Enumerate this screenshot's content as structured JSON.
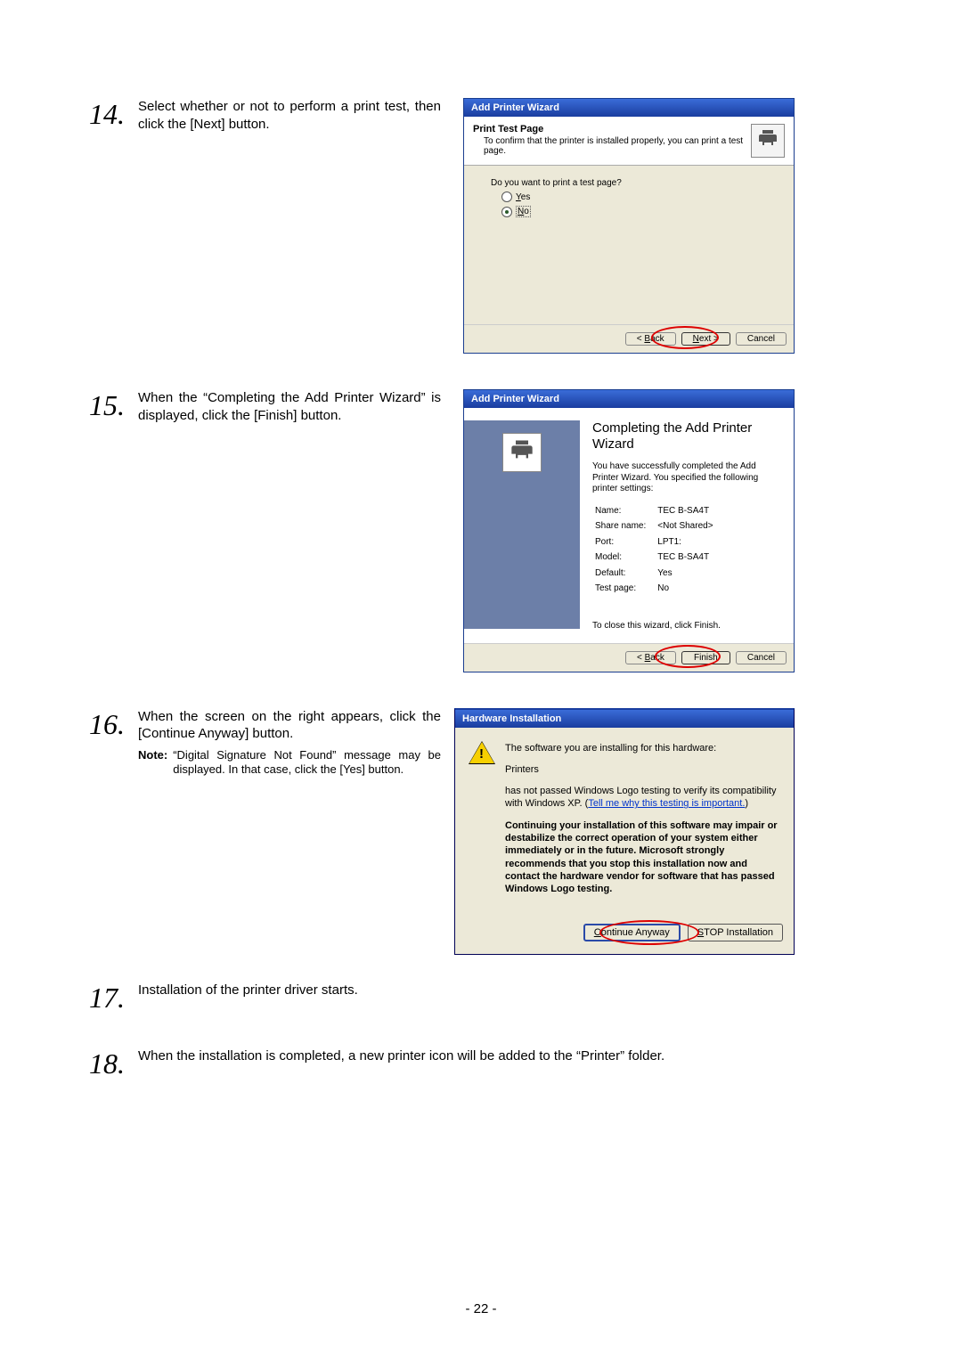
{
  "steps": {
    "s14": {
      "num": "14.",
      "text": "Select whether or not to perform a print test, then click the [Next] button."
    },
    "s15": {
      "num": "15.",
      "text": "When the “Completing the Add Printer Wizard” is displayed, click the [Finish] button."
    },
    "s16": {
      "num": "16.",
      "text": "When the screen on the right appears, click the [Continue Anyway] button.",
      "note_label": "Note:",
      "note_text": "“Digital Signature Not Found” message may be displayed.  In that case, click the [Yes] button."
    },
    "s17": {
      "num": "17.",
      "text": "Installation of the printer driver starts."
    },
    "s18": {
      "num": "18.",
      "text": "When the installation is completed, a new printer icon will be added to the “Printer” folder."
    }
  },
  "wizard1": {
    "title": "Add Printer Wizard",
    "header_title": "Print Test Page",
    "header_sub": "To confirm that the printer is installed properly, you can print a test page.",
    "question": "Do you want to print a test page?",
    "opt_yes_pre": "Y",
    "opt_yes_post": "es",
    "opt_no_pre": "N",
    "opt_no_post": "o",
    "back_pre": "< ",
    "back_u": "B",
    "back_post": "ack",
    "next_u": "N",
    "next_post": "ext >",
    "cancel": "Cancel"
  },
  "wizard2": {
    "title": "Add Printer Wizard",
    "complete_title": "Completing the Add Printer Wizard",
    "sub1": "You have successfully completed the Add Printer Wizard. You specified the following printer settings:",
    "labels": {
      "name": "Name:",
      "name_v": "TEC B-SA4T",
      "share": "Share name:",
      "share_v": "<Not Shared>",
      "port": "Port:",
      "port_v": "LPT1:",
      "model": "Model:",
      "model_v": "TEC B-SA4T",
      "default": "Default:",
      "default_v": "Yes",
      "test": "Test page:",
      "test_v": "No"
    },
    "close_text": "To close this wizard, click Finish.",
    "back_pre": "< ",
    "back_u": "B",
    "back_post": "ack",
    "finish": "Finish",
    "cancel": "Cancel"
  },
  "hw": {
    "title": "Hardware Installation",
    "line1": "The software you are installing for this hardware:",
    "line2": "Printers",
    "line3a": "has not passed Windows Logo testing to verify its compatibility with Windows XP. (",
    "link": "Tell me why this testing is important.",
    "line3b": ")",
    "warning": "Continuing your installation of this software may impair or destabilize the correct operation of your system either immediately or in the future. Microsoft strongly recommends that you stop this installation now and contact the hardware vendor for software that has passed Windows Logo testing.",
    "btn_continue_u": "C",
    "btn_continue_post": "ontinue Anyway",
    "btn_stop_u": "S",
    "btn_stop_post": "TOP Installation"
  },
  "page_number": "- 22 -"
}
